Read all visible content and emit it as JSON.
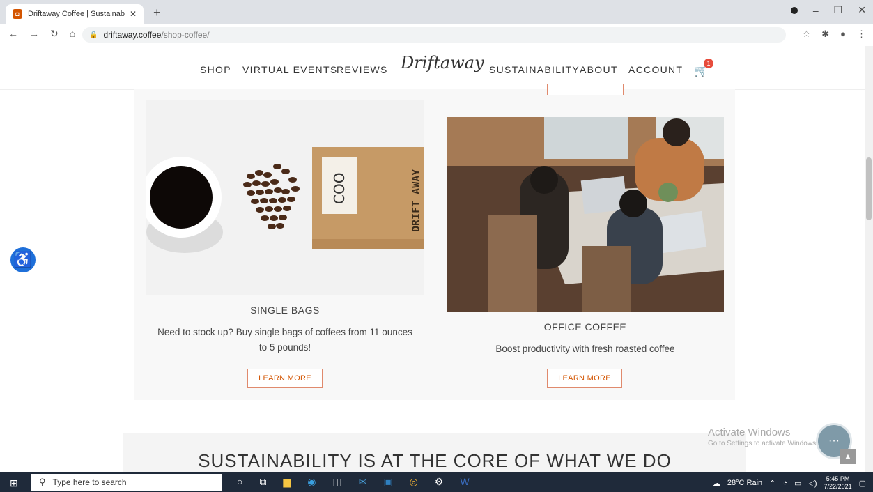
{
  "browser": {
    "tab_title": "Driftaway Coffee | Sustainable Co",
    "tab_close": "✕",
    "new_tab": "+",
    "url_domain": "driftaway.coffee",
    "url_path": "/shop-coffee/"
  },
  "site": {
    "nav_left": [
      "SHOP",
      "VIRTUAL EVENTS",
      "REVIEWS"
    ],
    "logo_text": "Driftaway",
    "nav_right": [
      "SUSTAINABILITY",
      "ABOUT",
      "ACCOUNT"
    ],
    "cart_count": "1"
  },
  "cards": [
    {
      "title": "SINGLE BAGS",
      "desc_line1": "Need to stock up? Buy single bags of coffees from 11 ounces",
      "desc_line2": "to 5 pounds!",
      "button": "LEARN MORE"
    },
    {
      "title": "OFFICE COFFEE",
      "desc_line1": "Boost productivity with fresh roasted coffee",
      "button": "LEARN MORE"
    }
  ],
  "bag_text": {
    "coo": "COO",
    "brand": "DRIFT AWAY"
  },
  "section_heading": "SUSTAINABILITY IS AT THE CORE OF WHAT WE DO",
  "watermark": {
    "line1": "Activate Windows",
    "line2": "Go to Settings to activate Windows."
  },
  "taskbar": {
    "search_placeholder": "Type here to search",
    "weather": "28°C Rain",
    "time": "5:45 PM",
    "date": "7/22/2021"
  }
}
